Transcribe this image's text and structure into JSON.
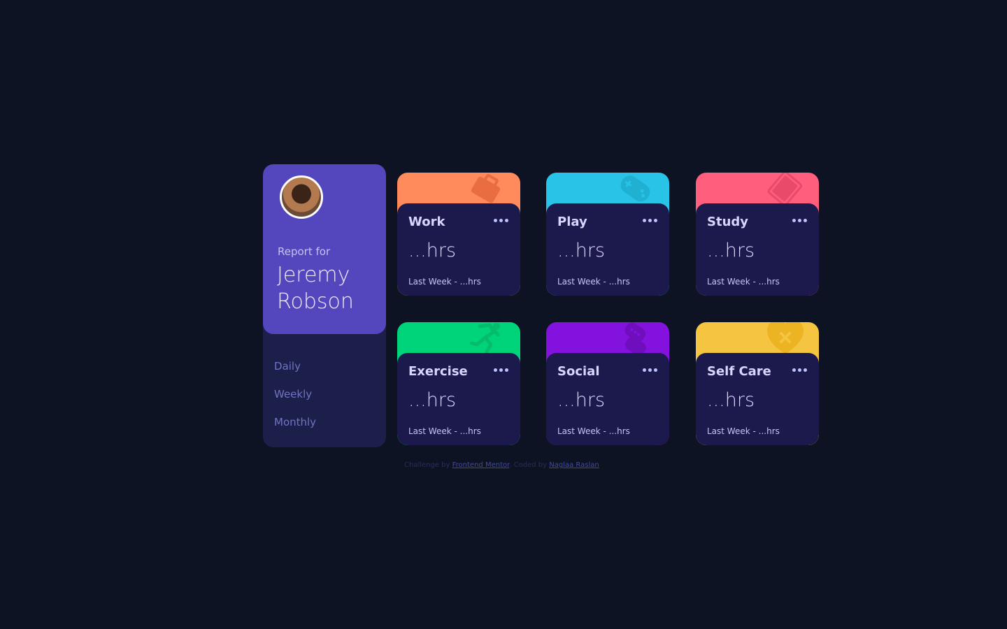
{
  "profile": {
    "report_for": "Report for",
    "name": "Jeremy Robson",
    "avatar_alt": "avatar"
  },
  "periods": [
    {
      "label": "Daily"
    },
    {
      "label": "Weekly"
    },
    {
      "label": "Monthly"
    }
  ],
  "cards": [
    {
      "title": "Work",
      "hours": "...hrs",
      "last": "Last Week - ...hrs",
      "color": "#ff8b5c",
      "icon": "briefcase-icon"
    },
    {
      "title": "Play",
      "hours": "...hrs",
      "last": "Last Week - ...hrs",
      "color": "#29c3e7",
      "icon": "gamepad-icon"
    },
    {
      "title": "Study",
      "hours": "...hrs",
      "last": "Last Week - ...hrs",
      "color": "#ff5e7d",
      "icon": "book-icon"
    },
    {
      "title": "Exercise",
      "hours": "...hrs",
      "last": "Last Week - ...hrs",
      "color": "#00d47b",
      "icon": "running-icon"
    },
    {
      "title": "Social",
      "hours": "...hrs",
      "last": "Last Week - ...hrs",
      "color": "#8312df",
      "icon": "social-icon"
    },
    {
      "title": "Self Care",
      "hours": "...hrs",
      "last": "Last Week - ...hrs",
      "color": "#f5c542",
      "icon": "heart-icon"
    }
  ],
  "footer": {
    "challenge_prefix": "Challenge by",
    "challenge_link": "Frontend Mentor",
    "coded_prefix": ". Coded by",
    "coded_link": "Naglaa Raslan"
  }
}
